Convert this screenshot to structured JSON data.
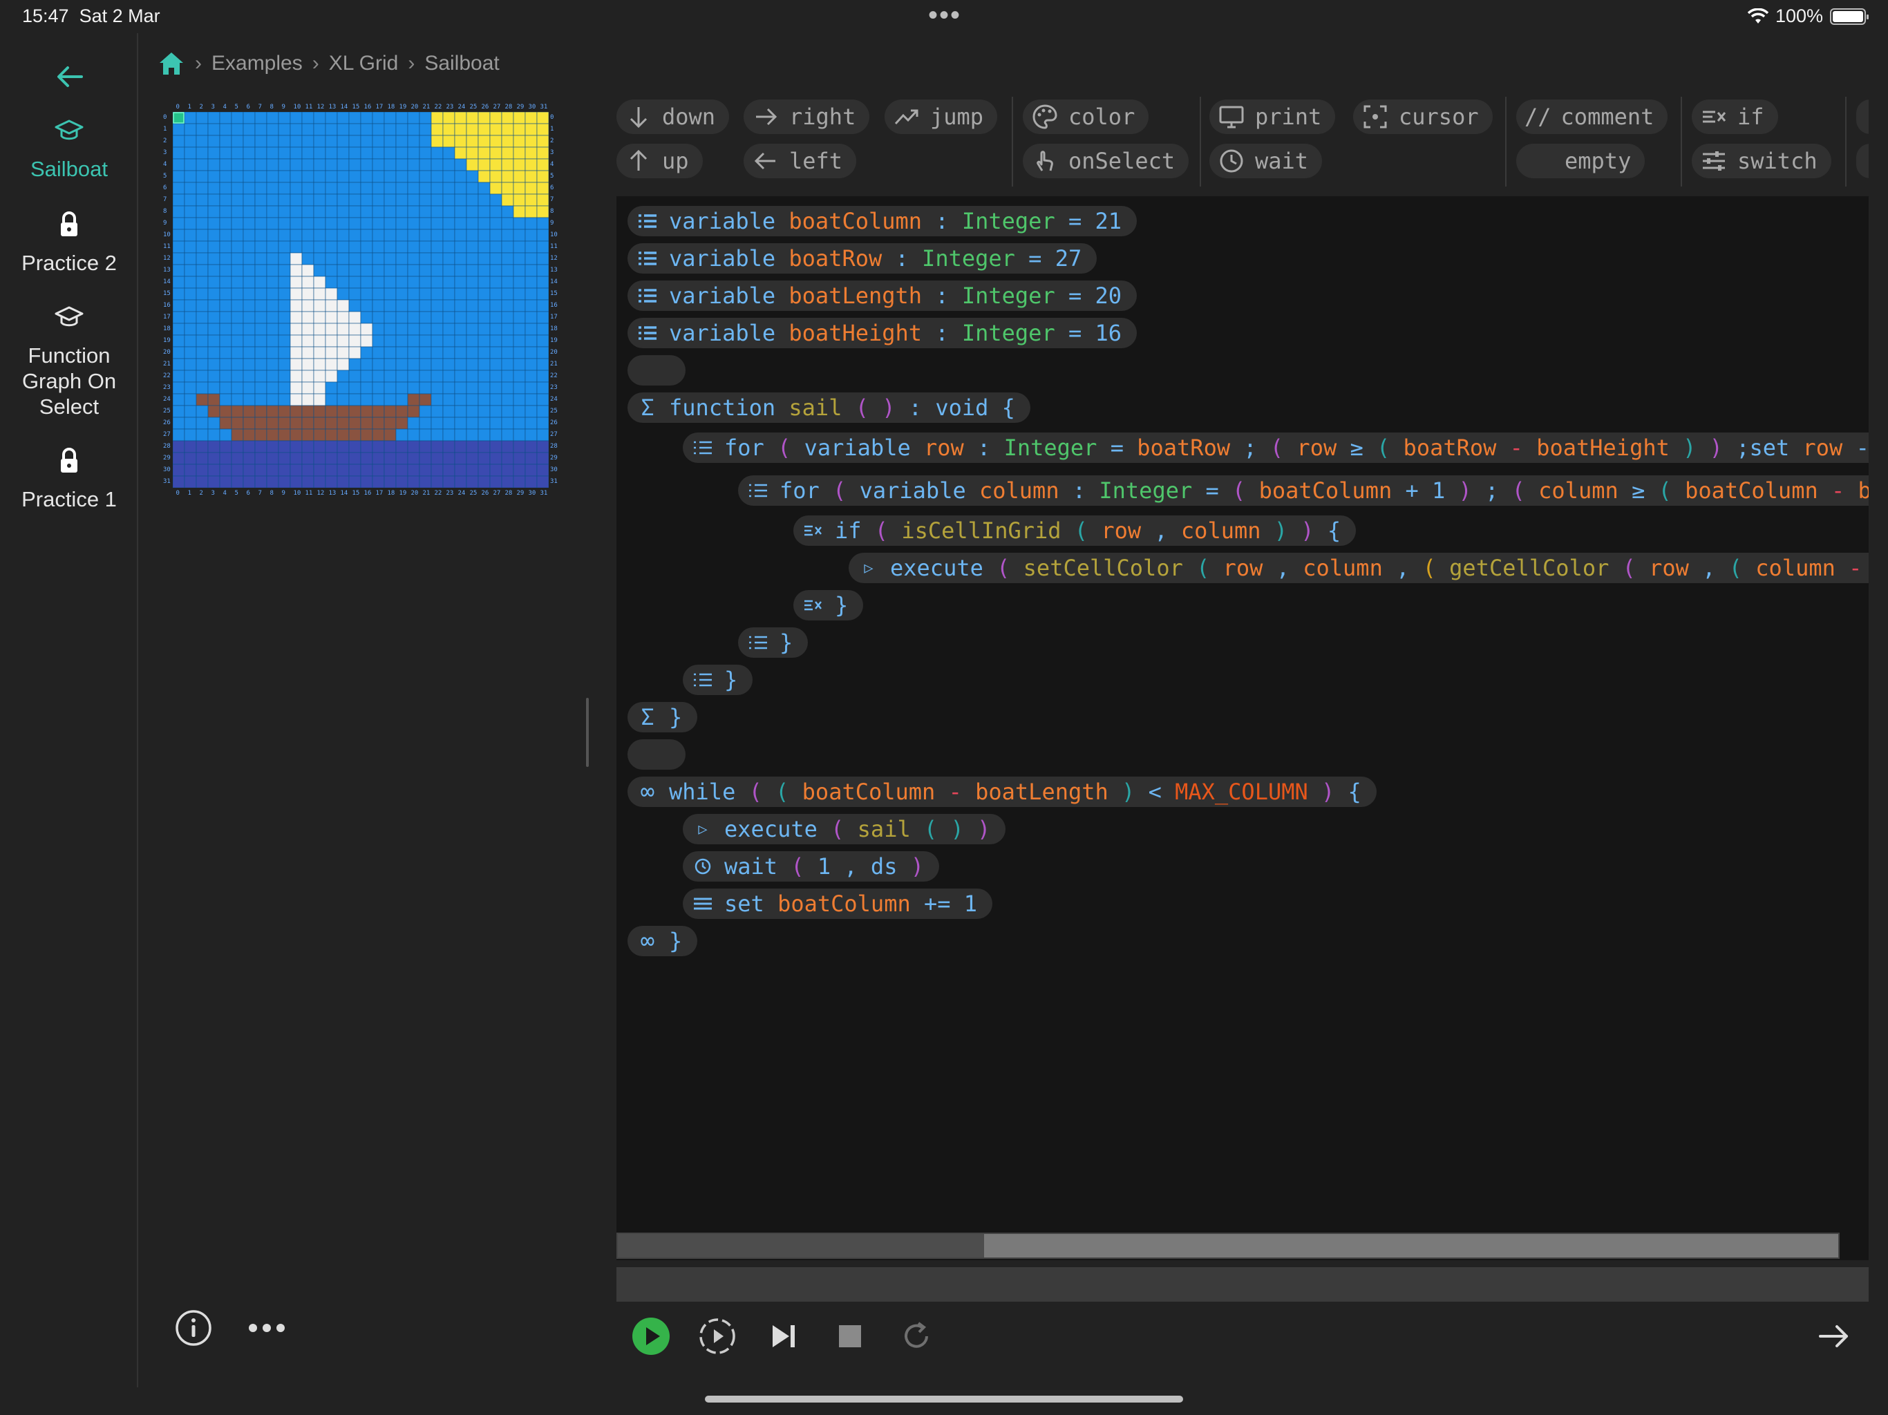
{
  "status": {
    "time": "15:47",
    "date": "Sat 2 Mar",
    "battery": "100%"
  },
  "sidebar": {
    "items": [
      {
        "label": "Sailboat",
        "icon": "graduation-cap-icon",
        "active": true
      },
      {
        "label": "Practice 2",
        "icon": "lock-icon",
        "active": false
      },
      {
        "label": "Function Graph On Select",
        "icon": "graduation-cap-icon",
        "active": false
      },
      {
        "label": "Practice 1",
        "icon": "lock-icon",
        "active": false
      }
    ]
  },
  "breadcrumb": [
    "Examples",
    "XL Grid",
    "Sailboat"
  ],
  "grid": {
    "size": 32,
    "colors": {
      "sky": "#1d8de8",
      "sun": "#f8e43a",
      "sail": "#f2f2f2",
      "hull": "#8a5340",
      "water": "#3b4ab0",
      "gridline": "#0d4f86"
    }
  },
  "toolbar": {
    "down": "down",
    "up": "up",
    "right": "right",
    "left": "left",
    "jump": "jump",
    "color": "color",
    "onSelect": "onSelect",
    "print": "print",
    "wait": "wait",
    "cursor": "cursor",
    "comment": "comment",
    "empty": "empty",
    "if": "if",
    "switch": "switch"
  },
  "code": {
    "v1_name": "boatColumn",
    "v1_val": "21",
    "v2_name": "boatRow",
    "v2_val": "27",
    "v3_name": "boatLength",
    "v3_val": "20",
    "v4_name": "boatHeight",
    "v4_val": "16",
    "kw_variable": "variable",
    "type_integer": "Integer",
    "kw_function": "function",
    "fn_sail": "sail",
    "type_void": "void",
    "kw_for": "for",
    "kw_set": "set",
    "var_row": "row",
    "var_column": "column",
    "kw_if": "if",
    "fn_isCellInGrid": "isCellInGrid",
    "kw_execute": "execute",
    "fn_setCellColor": "setCellColor",
    "fn_getCellColor": "getCellColor",
    "kw_while": "while",
    "const_max_column": "MAX_COLUMN",
    "kw_wait": "wait",
    "wait_num": "1",
    "wait_unit": "ds",
    "num_one": "1"
  },
  "scroll": {
    "thumb_fraction": 0.3
  }
}
